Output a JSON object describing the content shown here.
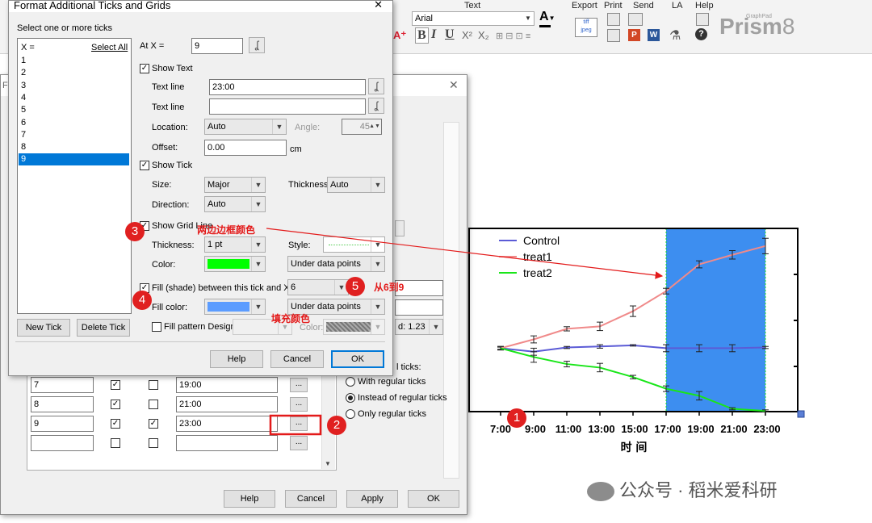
{
  "ribbon": {
    "text_group": "Text",
    "font_name": "Arial",
    "export": "Export",
    "print": "Print",
    "send": "Send",
    "la": "LA",
    "help": "Help",
    "brand": "Prism",
    "brand_version": "8",
    "brand_small": "GraphPad",
    "bold": "B",
    "italic": "I",
    "underline": "U"
  },
  "inner_dialog": {
    "title_frag": "Fo",
    "rows": [
      {
        "x": "7",
        "c1": true,
        "c2": false,
        "label": "19:00"
      },
      {
        "x": "8",
        "c1": true,
        "c2": false,
        "label": "21:00"
      },
      {
        "x": "9",
        "c1": true,
        "c2": true,
        "label": "23:00"
      },
      {
        "x": "",
        "c1": false,
        "c2": false,
        "label": ""
      }
    ],
    "ellipsis": "...",
    "ticks_label": "l ticks:",
    "radio_with": "With regular ticks",
    "radio_instead": "Instead of regular ticks",
    "radio_only": "Only regular ticks",
    "d_value": "d: 1.23",
    "help": "Help",
    "cancel": "Cancel",
    "apply": "Apply",
    "ok": "OK"
  },
  "format_dialog": {
    "title": "Format Additional Ticks and Grids",
    "close": "✕",
    "select_prompt": "Select one or more ticks",
    "list_header_x": "X =",
    "select_all": "Select All",
    "list_items": [
      "1",
      "2",
      "3",
      "4",
      "5",
      "6",
      "7",
      "8",
      "9"
    ],
    "selected_item": "9",
    "at_x_label": "At X =",
    "at_x_value": "9",
    "show_text": "Show Text",
    "text_line_label": "Text line",
    "text_line_1": "23:00",
    "text_line_2": "",
    "location_label": "Location:",
    "location_value": "Auto",
    "angle_label": "Angle:",
    "angle_value": "45",
    "offset_label": "Offset:",
    "offset_value": "0.00",
    "offset_unit": "cm",
    "show_tick": "Show Tick",
    "size_label": "Size:",
    "size_value": "Major",
    "thickness_label": "Thickness:",
    "thickness_tick_value": "Auto",
    "direction_label": "Direction:",
    "direction_value": "Auto",
    "show_grid_line": "Show Grid Line",
    "grid_thickness_label": "Thickness:",
    "grid_thickness_value": "1 pt",
    "style_label": "Style:",
    "color_label": "Color:",
    "grid_color": "#00ff00",
    "grid_layer": "Under data points",
    "fill_between": "Fill (shade) between this tick and X =",
    "fill_to_value": "6",
    "fill_color_label": "Fill color:",
    "fill_color": "#5b9cff",
    "fill_layer": "Under data points",
    "fill_pattern": "Fill pattern Design:",
    "pattern_color_label": "Color:",
    "new_tick": "New Tick",
    "delete_tick": "Delete Tick",
    "help": "Help",
    "cancel": "Cancel",
    "ok": "OK"
  },
  "annotations": {
    "b1": "1",
    "b2": "2",
    "b3": "3",
    "b4": "4",
    "b5": "5",
    "t3": "两边边框颜色",
    "t4": "填充颜色",
    "t5": "从6到9"
  },
  "watermark": "公众号 · 稻米爱科研",
  "chart_data": {
    "type": "line",
    "categories": [
      "7:00",
      "9:00",
      "11:00",
      "13:00",
      "15:00",
      "17:00",
      "19:00",
      "21:00",
      "23:00"
    ],
    "xlabel": "时 间",
    "shaded_range": [
      "17:00",
      "23:00"
    ],
    "shade_color": "#3d8ef0",
    "series": [
      {
        "name": "Control",
        "color": "#5b5bd6",
        "values": [
          0.0,
          -0.1,
          0.02,
          0.05,
          0.08,
          0.0,
          0.0,
          0.0,
          0.02
        ],
        "err": [
          0.03,
          0.1,
          0.03,
          0.05,
          0.02,
          0.1,
          0.1,
          0.1,
          0.03
        ]
      },
      {
        "name": "treat1",
        "color": "#f08a8a",
        "values": [
          0.0,
          0.25,
          0.55,
          0.62,
          1.05,
          1.62,
          2.38,
          2.65,
          2.9
        ],
        "err": [
          0.05,
          0.1,
          0.06,
          0.12,
          0.15,
          0.08,
          0.1,
          0.12,
          0.22
        ]
      },
      {
        "name": "treat2",
        "color": "#19e619",
        "values": [
          0.0,
          -0.25,
          -0.45,
          -0.55,
          -0.82,
          -1.15,
          -1.35,
          -1.72,
          -1.78
        ],
        "err": [
          0.05,
          0.15,
          0.08,
          0.12,
          0.05,
          0.08,
          0.12,
          0.03,
          0.03
        ]
      }
    ],
    "ylim": [
      -1.8,
      3.4
    ]
  }
}
